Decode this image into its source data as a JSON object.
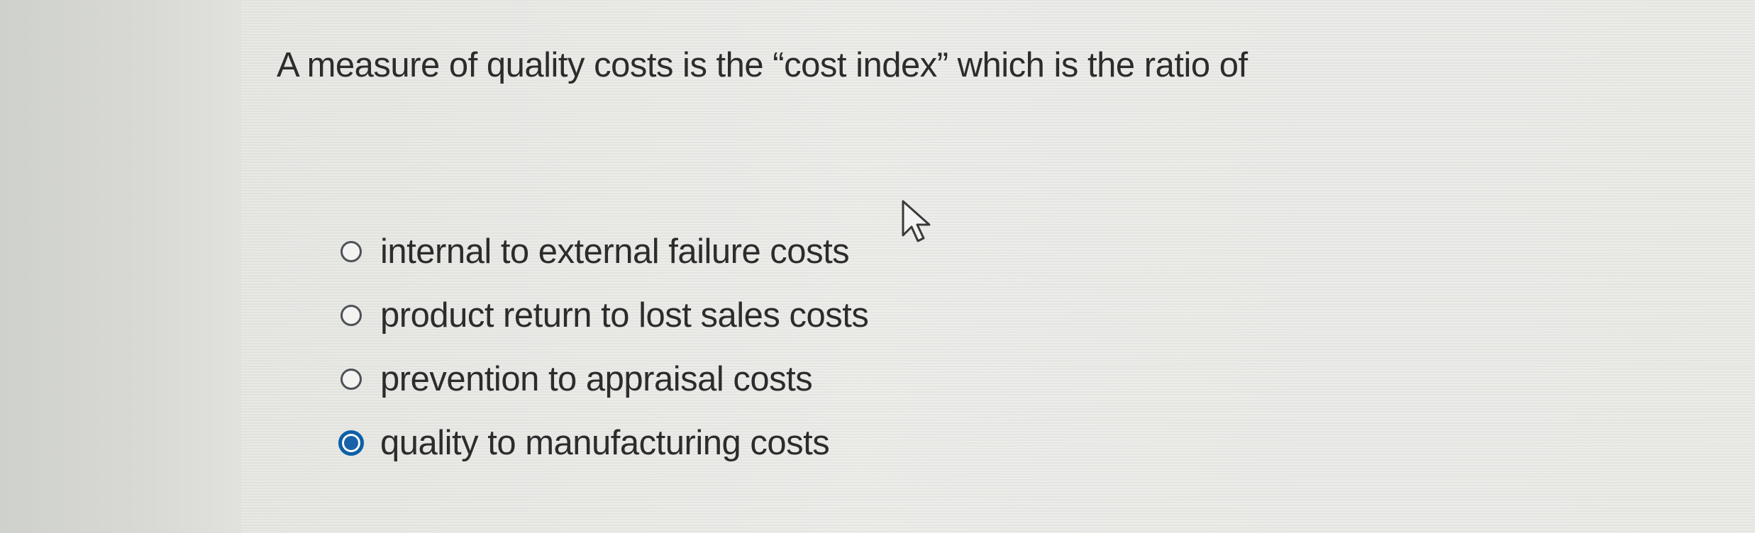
{
  "question": {
    "text": "A measure of quality costs is the “cost index” which is the ratio of"
  },
  "options": [
    {
      "label": "internal to external failure costs",
      "selected": false
    },
    {
      "label": "product return to lost sales costs",
      "selected": false
    },
    {
      "label": "prevention to appraisal costs",
      "selected": false
    },
    {
      "label": "quality to manufacturing costs",
      "selected": true
    }
  ],
  "icons": {
    "cursor": "mouse-pointer-arrow"
  },
  "colors": {
    "selected_radio": "#1a62a8",
    "text": "#2c2c2c"
  }
}
